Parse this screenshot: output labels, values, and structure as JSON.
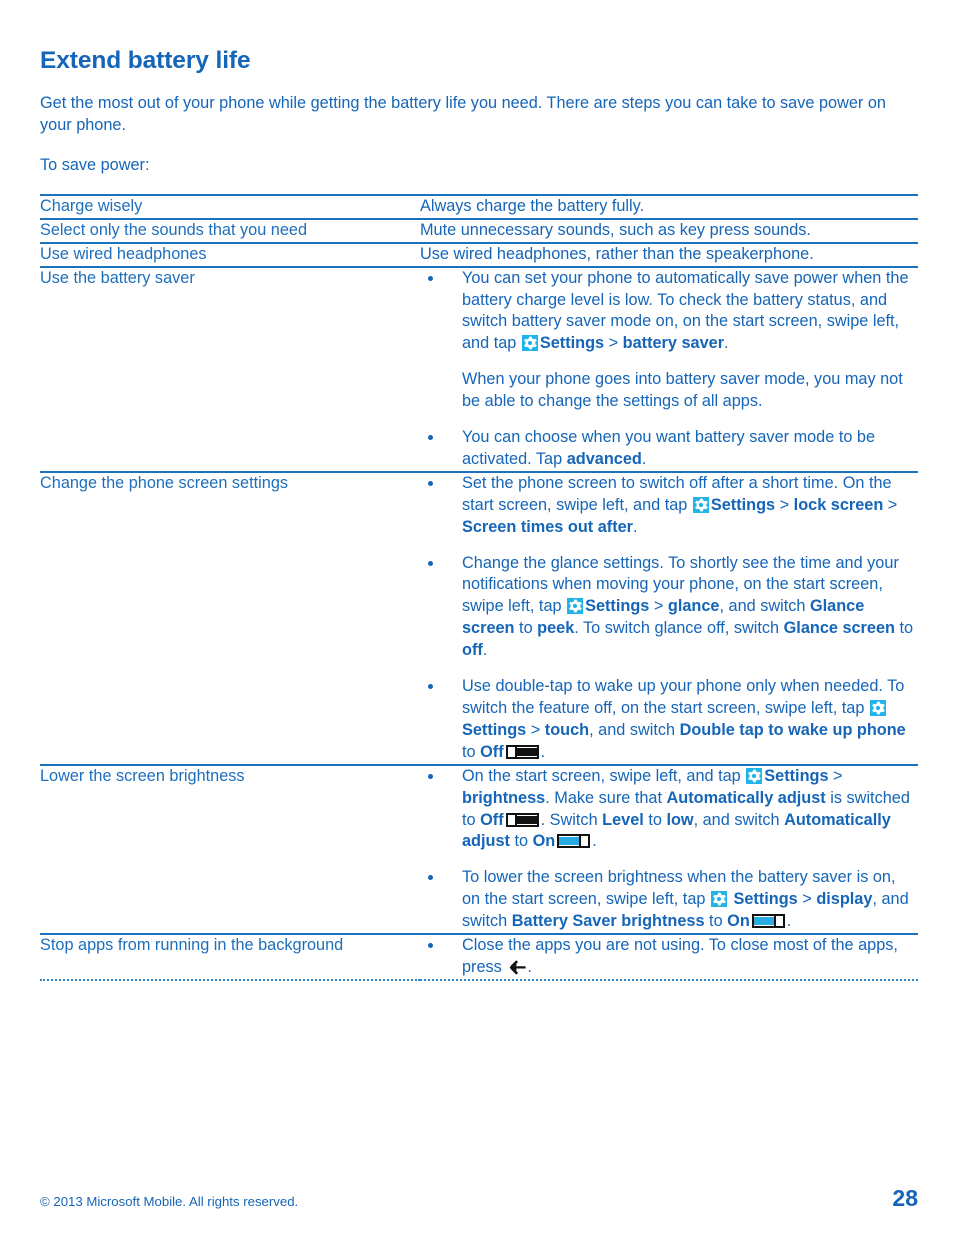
{
  "document": {
    "title": "Extend battery life",
    "intro": "Get the most out of your phone while getting the battery life you need. There are steps you can take to save power on your phone.",
    "lead": "To save power:"
  },
  "icons": {
    "settings_tile": "settings-gear-icon",
    "toggle_off": "toggle-switch-off-icon",
    "toggle_on": "toggle-switch-on-icon",
    "back_arrow": "back-arrow-icon"
  },
  "colors": {
    "text_blue": "#1565b8",
    "rule_blue": "#1a72bd",
    "tile_cyan": "#22b3e8",
    "toggle_on_fill": "#29aae1",
    "toggle_border": "#111111"
  },
  "table": {
    "rows": [
      {
        "term": "Charge wisely",
        "desc_plain": "Always charge the battery fully."
      },
      {
        "term": "Select only the sounds that you need",
        "desc_plain": "Mute unnecessary sounds, such as key press sounds."
      },
      {
        "term": "Use wired headphones",
        "desc_plain": "Use wired headphones, rather than the speakerphone."
      },
      {
        "term": "Use the battery saver",
        "bullets": [
          {
            "text_1": "You can set your phone to automatically save power when the battery charge level is low. To check the battery status, and switch battery saver mode on, on the start screen, swipe left, and tap",
            "bold_1": "Settings",
            "text_2": " > ",
            "bold_2": "battery saver",
            "text_3": ".",
            "sub_para": "When your phone goes into battery saver mode, you may not be able to change the settings of all apps."
          },
          {
            "text_1": "You can choose when you want battery saver mode to be activated. Tap ",
            "bold_1": "advanced",
            "text_2": "."
          }
        ]
      },
      {
        "term": "Change the phone screen settings",
        "bullets": [
          {
            "text_1": "Set the phone screen to switch off after a short time. On the start screen, swipe left, and tap",
            "bold_1": "Settings",
            "text_2": " > ",
            "bold_2": "lock screen",
            "text_3": " > ",
            "bold_3": "Screen times out after",
            "text_4": "."
          },
          {
            "text_1": "Change the glance settings. To shortly see the time and your notifications when moving your phone, on the start screen, swipe left, tap",
            "bold_1": "Settings",
            "text_2": " > ",
            "bold_2": "glance",
            "text_3": ", and switch ",
            "bold_3": "Glance screen",
            "text_4": " to ",
            "bold_4": "peek",
            "text_5": ". To switch glance off, switch ",
            "bold_5": "Glance screen",
            "text_6": " to ",
            "bold_6": "off",
            "text_7": "."
          },
          {
            "text_1": "Use double-tap to wake up your phone only when needed. To switch the feature off, on the start screen, swipe left, tap",
            "bold_1": "Settings",
            "text_2": " > ",
            "bold_2": "touch",
            "text_3": ", and switch ",
            "bold_3": "Double tap to wake up phone",
            "text_4": " to ",
            "bold_4": "Off",
            "text_5": "."
          }
        ]
      },
      {
        "term": "Lower the screen brightness",
        "bullets": [
          {
            "text_1": "On the start screen, swipe left, and tap",
            "bold_1": "Settings",
            "text_2": " > ",
            "bold_2": "brightness",
            "text_3": ". Make sure that ",
            "bold_3": "Automatically adjust",
            "text_4": " is switched to ",
            "bold_4": "Off",
            "text_5": ". Switch ",
            "bold_5": "Level",
            "text_6": " to ",
            "bold_6": "low",
            "text_7": ", and switch ",
            "bold_7": "Automatically adjust",
            "text_8": " to ",
            "bold_8": "On",
            "text_9": "."
          },
          {
            "text_1": "To lower the screen brightness when the battery saver is on, on the start screen, swipe left, tap",
            "bold_1": "Settings",
            "text_2": " > ",
            "bold_2": "display",
            "text_3": ", and switch ",
            "bold_3": "Battery Saver brightness",
            "text_4": " to ",
            "bold_4": "On",
            "text_5": "."
          }
        ]
      },
      {
        "term": "Stop apps from running in the background",
        "bullets": [
          {
            "text_1": "Close the apps you are not using. To close most of the apps, press ",
            "text_2": "."
          }
        ]
      }
    ]
  },
  "footer": {
    "copyright": "© 2013 Microsoft Mobile. All rights reserved.",
    "page_number": "28"
  }
}
